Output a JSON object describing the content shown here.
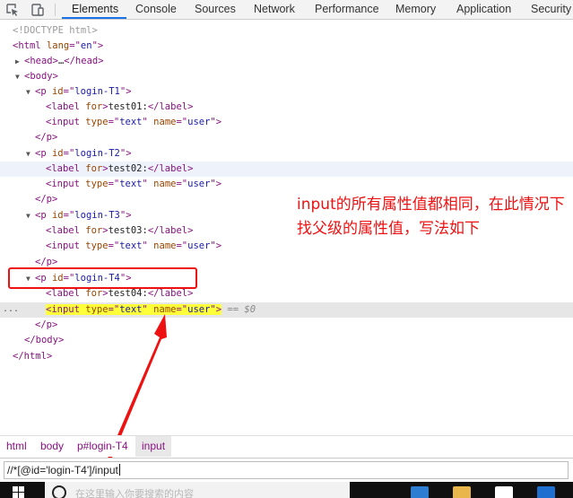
{
  "toolbar": {
    "tabs": [
      {
        "label": "Elements",
        "active": true
      },
      {
        "label": "Console",
        "active": false
      },
      {
        "label": "Sources",
        "active": false
      },
      {
        "label": "Network",
        "active": false
      },
      {
        "label": "Performance",
        "active": false
      },
      {
        "label": "Memory",
        "active": false
      },
      {
        "label": "Application",
        "active": false
      },
      {
        "label": "Security",
        "active": false
      }
    ],
    "icons": [
      "inspect-element-icon",
      "device-toolbar-icon"
    ]
  },
  "dom": {
    "doctype": "<!DOCTYPE html>",
    "html_open": {
      "tag": "html",
      "attr": "lang",
      "value": "en"
    },
    "head_collapsed": {
      "open": "head",
      "ellipsis": "…",
      "close": "/head"
    },
    "body_tag": "body",
    "p_tag": "p",
    "p_attr": "id",
    "label_tag": "label",
    "label_attr": "for",
    "input_tag": "input",
    "input_attr_type": "type",
    "input_attr_name": "name",
    "input_type_value": "text",
    "input_name_value": "user",
    "groups": [
      {
        "id": "login-T1",
        "label_text": "test01:"
      },
      {
        "id": "login-T2",
        "label_text": "test02:"
      },
      {
        "id": "login-T3",
        "label_text": "test03:"
      },
      {
        "id": "login-T4",
        "label_text": "test04:"
      }
    ],
    "selected_suffix": "== $0",
    "ellipsis_marker": "...",
    "p_close": "/p",
    "body_close": "/body",
    "html_close": "/html"
  },
  "annotation": {
    "text": "input的所有属性值都相同，在此情况下找父级的属性值，写法如下",
    "color": "#ee1111"
  },
  "breadcrumb": [
    {
      "label": "html",
      "selected": false
    },
    {
      "label": "body",
      "selected": false
    },
    {
      "label": "p#login-T4",
      "selected": false
    },
    {
      "label": "input",
      "selected": true
    }
  ],
  "search": {
    "value": "//*[@id='login-T4']/input"
  },
  "taskbar": {
    "cortana_placeholder": "在这里输入你要搜索的内容",
    "apps": [
      {
        "icon": "edge-icon",
        "color": "#2d7dd2"
      },
      {
        "icon": "file-explorer-icon",
        "color": "#e8b64a"
      },
      {
        "icon": "store-icon",
        "color": "#ffffff"
      },
      {
        "icon": "mail-icon",
        "color": "#1e6fd0"
      }
    ]
  },
  "colors": {
    "tag": "#881280",
    "attr_name": "#994500",
    "attr_value": "#1a1aa6",
    "selection_highlight": "#ffff3a",
    "active_tab_underline": "#1a73e8"
  }
}
